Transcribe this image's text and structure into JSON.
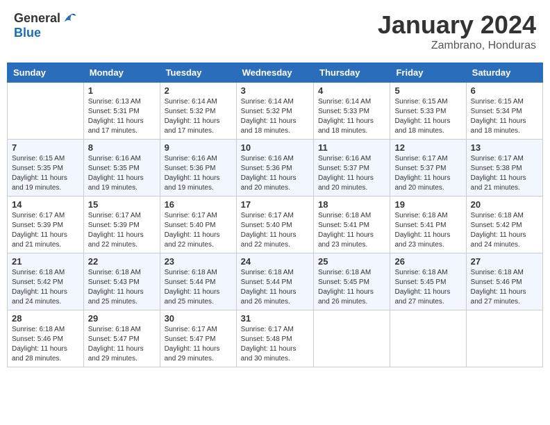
{
  "logo": {
    "general": "General",
    "blue": "Blue"
  },
  "title": "January 2024",
  "subtitle": "Zambrano, Honduras",
  "days_of_week": [
    "Sunday",
    "Monday",
    "Tuesday",
    "Wednesday",
    "Thursday",
    "Friday",
    "Saturday"
  ],
  "weeks": [
    [
      {
        "number": "",
        "sunrise": "",
        "sunset": "",
        "daylight": ""
      },
      {
        "number": "1",
        "sunrise": "Sunrise: 6:13 AM",
        "sunset": "Sunset: 5:31 PM",
        "daylight": "Daylight: 11 hours and 17 minutes."
      },
      {
        "number": "2",
        "sunrise": "Sunrise: 6:14 AM",
        "sunset": "Sunset: 5:32 PM",
        "daylight": "Daylight: 11 hours and 17 minutes."
      },
      {
        "number": "3",
        "sunrise": "Sunrise: 6:14 AM",
        "sunset": "Sunset: 5:32 PM",
        "daylight": "Daylight: 11 hours and 18 minutes."
      },
      {
        "number": "4",
        "sunrise": "Sunrise: 6:14 AM",
        "sunset": "Sunset: 5:33 PM",
        "daylight": "Daylight: 11 hours and 18 minutes."
      },
      {
        "number": "5",
        "sunrise": "Sunrise: 6:15 AM",
        "sunset": "Sunset: 5:33 PM",
        "daylight": "Daylight: 11 hours and 18 minutes."
      },
      {
        "number": "6",
        "sunrise": "Sunrise: 6:15 AM",
        "sunset": "Sunset: 5:34 PM",
        "daylight": "Daylight: 11 hours and 18 minutes."
      }
    ],
    [
      {
        "number": "7",
        "sunrise": "Sunrise: 6:15 AM",
        "sunset": "Sunset: 5:35 PM",
        "daylight": "Daylight: 11 hours and 19 minutes."
      },
      {
        "number": "8",
        "sunrise": "Sunrise: 6:16 AM",
        "sunset": "Sunset: 5:35 PM",
        "daylight": "Daylight: 11 hours and 19 minutes."
      },
      {
        "number": "9",
        "sunrise": "Sunrise: 6:16 AM",
        "sunset": "Sunset: 5:36 PM",
        "daylight": "Daylight: 11 hours and 19 minutes."
      },
      {
        "number": "10",
        "sunrise": "Sunrise: 6:16 AM",
        "sunset": "Sunset: 5:36 PM",
        "daylight": "Daylight: 11 hours and 20 minutes."
      },
      {
        "number": "11",
        "sunrise": "Sunrise: 6:16 AM",
        "sunset": "Sunset: 5:37 PM",
        "daylight": "Daylight: 11 hours and 20 minutes."
      },
      {
        "number": "12",
        "sunrise": "Sunrise: 6:17 AM",
        "sunset": "Sunset: 5:37 PM",
        "daylight": "Daylight: 11 hours and 20 minutes."
      },
      {
        "number": "13",
        "sunrise": "Sunrise: 6:17 AM",
        "sunset": "Sunset: 5:38 PM",
        "daylight": "Daylight: 11 hours and 21 minutes."
      }
    ],
    [
      {
        "number": "14",
        "sunrise": "Sunrise: 6:17 AM",
        "sunset": "Sunset: 5:39 PM",
        "daylight": "Daylight: 11 hours and 21 minutes."
      },
      {
        "number": "15",
        "sunrise": "Sunrise: 6:17 AM",
        "sunset": "Sunset: 5:39 PM",
        "daylight": "Daylight: 11 hours and 22 minutes."
      },
      {
        "number": "16",
        "sunrise": "Sunrise: 6:17 AM",
        "sunset": "Sunset: 5:40 PM",
        "daylight": "Daylight: 11 hours and 22 minutes."
      },
      {
        "number": "17",
        "sunrise": "Sunrise: 6:17 AM",
        "sunset": "Sunset: 5:40 PM",
        "daylight": "Daylight: 11 hours and 22 minutes."
      },
      {
        "number": "18",
        "sunrise": "Sunrise: 6:18 AM",
        "sunset": "Sunset: 5:41 PM",
        "daylight": "Daylight: 11 hours and 23 minutes."
      },
      {
        "number": "19",
        "sunrise": "Sunrise: 6:18 AM",
        "sunset": "Sunset: 5:41 PM",
        "daylight": "Daylight: 11 hours and 23 minutes."
      },
      {
        "number": "20",
        "sunrise": "Sunrise: 6:18 AM",
        "sunset": "Sunset: 5:42 PM",
        "daylight": "Daylight: 11 hours and 24 minutes."
      }
    ],
    [
      {
        "number": "21",
        "sunrise": "Sunrise: 6:18 AM",
        "sunset": "Sunset: 5:42 PM",
        "daylight": "Daylight: 11 hours and 24 minutes."
      },
      {
        "number": "22",
        "sunrise": "Sunrise: 6:18 AM",
        "sunset": "Sunset: 5:43 PM",
        "daylight": "Daylight: 11 hours and 25 minutes."
      },
      {
        "number": "23",
        "sunrise": "Sunrise: 6:18 AM",
        "sunset": "Sunset: 5:44 PM",
        "daylight": "Daylight: 11 hours and 25 minutes."
      },
      {
        "number": "24",
        "sunrise": "Sunrise: 6:18 AM",
        "sunset": "Sunset: 5:44 PM",
        "daylight": "Daylight: 11 hours and 26 minutes."
      },
      {
        "number": "25",
        "sunrise": "Sunrise: 6:18 AM",
        "sunset": "Sunset: 5:45 PM",
        "daylight": "Daylight: 11 hours and 26 minutes."
      },
      {
        "number": "26",
        "sunrise": "Sunrise: 6:18 AM",
        "sunset": "Sunset: 5:45 PM",
        "daylight": "Daylight: 11 hours and 27 minutes."
      },
      {
        "number": "27",
        "sunrise": "Sunrise: 6:18 AM",
        "sunset": "Sunset: 5:46 PM",
        "daylight": "Daylight: 11 hours and 27 minutes."
      }
    ],
    [
      {
        "number": "28",
        "sunrise": "Sunrise: 6:18 AM",
        "sunset": "Sunset: 5:46 PM",
        "daylight": "Daylight: 11 hours and 28 minutes."
      },
      {
        "number": "29",
        "sunrise": "Sunrise: 6:18 AM",
        "sunset": "Sunset: 5:47 PM",
        "daylight": "Daylight: 11 hours and 29 minutes."
      },
      {
        "number": "30",
        "sunrise": "Sunrise: 6:17 AM",
        "sunset": "Sunset: 5:47 PM",
        "daylight": "Daylight: 11 hours and 29 minutes."
      },
      {
        "number": "31",
        "sunrise": "Sunrise: 6:17 AM",
        "sunset": "Sunset: 5:48 PM",
        "daylight": "Daylight: 11 hours and 30 minutes."
      },
      {
        "number": "",
        "sunrise": "",
        "sunset": "",
        "daylight": ""
      },
      {
        "number": "",
        "sunrise": "",
        "sunset": "",
        "daylight": ""
      },
      {
        "number": "",
        "sunrise": "",
        "sunset": "",
        "daylight": ""
      }
    ]
  ]
}
